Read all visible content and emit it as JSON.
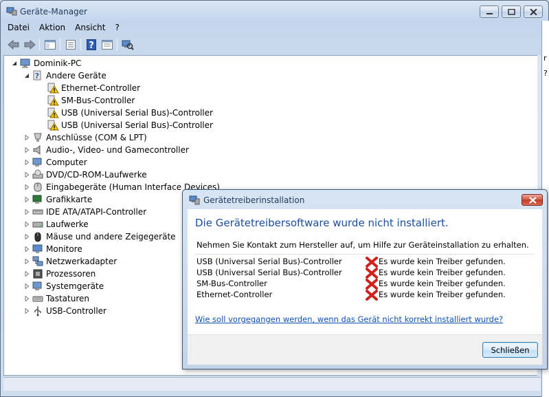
{
  "window": {
    "title": "Geräte-Manager",
    "icon": "device-manager-icon"
  },
  "menu": [
    "Datei",
    "Aktion",
    "Ansicht",
    "?"
  ],
  "toolbar": [
    "back-icon",
    "forward-icon",
    "show-hide-tree-icon",
    "properties-icon",
    "help-icon",
    "view-icon",
    "scan-hardware-icon"
  ],
  "tree": {
    "root": "Dominik-PC",
    "items": [
      {
        "label": "Andere Geräte",
        "expanded": true,
        "icon": "unknown-devices-icon",
        "children": [
          {
            "label": "Ethernet-Controller",
            "icon": "warning-device-icon"
          },
          {
            "label": "SM-Bus-Controller",
            "icon": "warning-device-icon"
          },
          {
            "label": "USB (Universal Serial Bus)-Controller",
            "icon": "warning-device-icon"
          },
          {
            "label": "USB (Universal Serial Bus)-Controller",
            "icon": "warning-device-icon"
          }
        ]
      },
      {
        "label": "Anschlüsse (COM & LPT)",
        "icon": "port-icon"
      },
      {
        "label": "Audio-, Video- und Gamecontroller",
        "icon": "audio-icon"
      },
      {
        "label": "Computer",
        "icon": "computer-icon"
      },
      {
        "label": "DVD/CD-ROM-Laufwerke",
        "icon": "dvd-drive-icon"
      },
      {
        "label": "Eingabegeräte (Human Interface Devices)",
        "icon": "hid-icon"
      },
      {
        "label": "Grafikkarte",
        "icon": "graphics-card-icon"
      },
      {
        "label": "IDE ATA/ATAPI-Controller",
        "icon": "ide-controller-icon"
      },
      {
        "label": "Laufwerke",
        "icon": "disk-drive-icon"
      },
      {
        "label": "Mäuse und andere Zeigegeräte",
        "icon": "mouse-icon"
      },
      {
        "label": "Monitore",
        "icon": "monitor-icon"
      },
      {
        "label": "Netzwerkadapter",
        "icon": "network-adapter-icon"
      },
      {
        "label": "Prozessoren",
        "icon": "processor-icon"
      },
      {
        "label": "Systemgeräte",
        "icon": "system-devices-icon"
      },
      {
        "label": "Tastaturen",
        "icon": "keyboard-icon"
      },
      {
        "label": "USB-Controller",
        "icon": "usb-icon"
      }
    ]
  },
  "right_edge_text": [
    "r",
    "?"
  ],
  "dialog": {
    "title": "Gerätetreiberinstallation",
    "heading": "Die Gerätetreibersoftware wurde nicht installiert.",
    "info": "Nehmen Sie Kontakt zum Hersteller auf, um Hilfe zur Geräteinstallation zu erhalten.",
    "devices": [
      {
        "name": "USB (Universal Serial Bus)-Controller",
        "status": "Es wurde kein Treiber gefunden."
      },
      {
        "name": "USB (Universal Serial Bus)-Controller",
        "status": "Es wurde kein Treiber gefunden."
      },
      {
        "name": "SM-Bus-Controller",
        "status": "Es wurde kein Treiber gefunden."
      },
      {
        "name": "Ethernet-Controller",
        "status": "Es wurde kein Treiber gefunden."
      }
    ],
    "link": "Wie soll vorgegangen werden, wenn das Gerät nicht korrekt installiert wurde?",
    "close_button": "Schließen"
  },
  "colors": {
    "heading": "#1b4e9c",
    "link": "#0e52b3",
    "error": "#d0211c",
    "warning": "#f3c600"
  }
}
